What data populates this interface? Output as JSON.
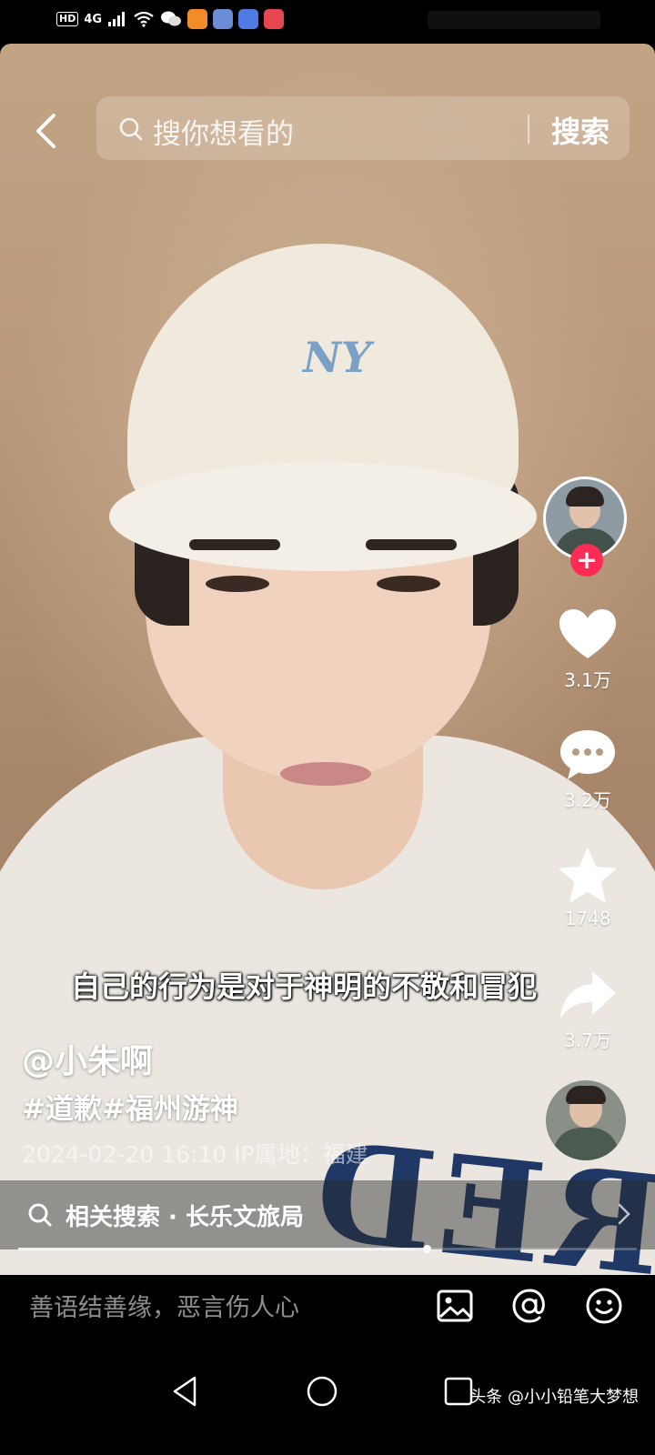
{
  "status_bar": {
    "hd": "HD",
    "network": "4G"
  },
  "search": {
    "placeholder": "搜你想看的",
    "button_label": "搜索"
  },
  "video": {
    "subtitle": "自己的行为是对于神明的不敬和冒犯",
    "author": "@小朱啊",
    "hashtags": "#道歉#福州游神",
    "meta": "2024-02-20 16:10 IP属地：福建",
    "cap_logo": "NY",
    "shirt_text": "RED SOX",
    "progress": 0.66
  },
  "actions": {
    "likes": "3.1万",
    "comments": "3.2万",
    "favorites": "1748",
    "shares": "3.7万"
  },
  "related_search": {
    "label": "相关搜索 · 长乐文旅局"
  },
  "comment_bar": {
    "placeholder": "善语结善缘，恶言伤人心"
  },
  "watermark": "头条 @小小铅笔大梦想",
  "colors": {
    "follow_red": "#fe2c55",
    "background": "#000000"
  },
  "icons": [
    "back-icon",
    "search-icon",
    "plus-icon",
    "heart-icon",
    "comment-icon",
    "star-icon",
    "share-icon",
    "chevron-right-icon",
    "image-icon",
    "at-icon",
    "emoji-icon",
    "nav-back-icon",
    "nav-home-icon",
    "nav-recents-icon"
  ]
}
